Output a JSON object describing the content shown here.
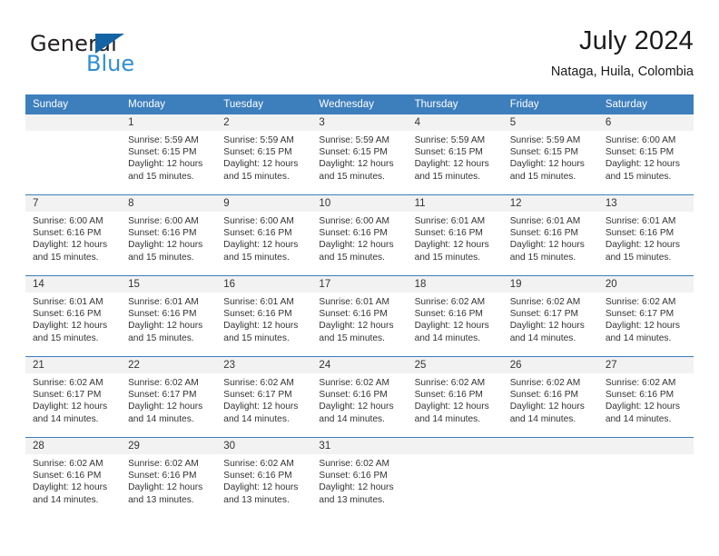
{
  "brand": {
    "name_part1": "General",
    "name_part2": "Blue",
    "accent_color": "#1464a5",
    "secondary_color": "#2e8fd4"
  },
  "header": {
    "title": "July 2024",
    "location": "Nataga, Huila, Colombia"
  },
  "theme": {
    "header_band": "#3d7ebd",
    "daynum_band": "#f2f2f2",
    "text": "#333333"
  },
  "weekday_headers": [
    "Sunday",
    "Monday",
    "Tuesday",
    "Wednesday",
    "Thursday",
    "Friday",
    "Saturday"
  ],
  "weeks": [
    [
      {
        "day": "",
        "sunrise": "",
        "sunset": "",
        "daylight_line1": "",
        "daylight_line2": ""
      },
      {
        "day": "1",
        "sunrise": "Sunrise: 5:59 AM",
        "sunset": "Sunset: 6:15 PM",
        "daylight_line1": "Daylight: 12 hours",
        "daylight_line2": "and 15 minutes."
      },
      {
        "day": "2",
        "sunrise": "Sunrise: 5:59 AM",
        "sunset": "Sunset: 6:15 PM",
        "daylight_line1": "Daylight: 12 hours",
        "daylight_line2": "and 15 minutes."
      },
      {
        "day": "3",
        "sunrise": "Sunrise: 5:59 AM",
        "sunset": "Sunset: 6:15 PM",
        "daylight_line1": "Daylight: 12 hours",
        "daylight_line2": "and 15 minutes."
      },
      {
        "day": "4",
        "sunrise": "Sunrise: 5:59 AM",
        "sunset": "Sunset: 6:15 PM",
        "daylight_line1": "Daylight: 12 hours",
        "daylight_line2": "and 15 minutes."
      },
      {
        "day": "5",
        "sunrise": "Sunrise: 5:59 AM",
        "sunset": "Sunset: 6:15 PM",
        "daylight_line1": "Daylight: 12 hours",
        "daylight_line2": "and 15 minutes."
      },
      {
        "day": "6",
        "sunrise": "Sunrise: 6:00 AM",
        "sunset": "Sunset: 6:15 PM",
        "daylight_line1": "Daylight: 12 hours",
        "daylight_line2": "and 15 minutes."
      }
    ],
    [
      {
        "day": "7",
        "sunrise": "Sunrise: 6:00 AM",
        "sunset": "Sunset: 6:16 PM",
        "daylight_line1": "Daylight: 12 hours",
        "daylight_line2": "and 15 minutes."
      },
      {
        "day": "8",
        "sunrise": "Sunrise: 6:00 AM",
        "sunset": "Sunset: 6:16 PM",
        "daylight_line1": "Daylight: 12 hours",
        "daylight_line2": "and 15 minutes."
      },
      {
        "day": "9",
        "sunrise": "Sunrise: 6:00 AM",
        "sunset": "Sunset: 6:16 PM",
        "daylight_line1": "Daylight: 12 hours",
        "daylight_line2": "and 15 minutes."
      },
      {
        "day": "10",
        "sunrise": "Sunrise: 6:00 AM",
        "sunset": "Sunset: 6:16 PM",
        "daylight_line1": "Daylight: 12 hours",
        "daylight_line2": "and 15 minutes."
      },
      {
        "day": "11",
        "sunrise": "Sunrise: 6:01 AM",
        "sunset": "Sunset: 6:16 PM",
        "daylight_line1": "Daylight: 12 hours",
        "daylight_line2": "and 15 minutes."
      },
      {
        "day": "12",
        "sunrise": "Sunrise: 6:01 AM",
        "sunset": "Sunset: 6:16 PM",
        "daylight_line1": "Daylight: 12 hours",
        "daylight_line2": "and 15 minutes."
      },
      {
        "day": "13",
        "sunrise": "Sunrise: 6:01 AM",
        "sunset": "Sunset: 6:16 PM",
        "daylight_line1": "Daylight: 12 hours",
        "daylight_line2": "and 15 minutes."
      }
    ],
    [
      {
        "day": "14",
        "sunrise": "Sunrise: 6:01 AM",
        "sunset": "Sunset: 6:16 PM",
        "daylight_line1": "Daylight: 12 hours",
        "daylight_line2": "and 15 minutes."
      },
      {
        "day": "15",
        "sunrise": "Sunrise: 6:01 AM",
        "sunset": "Sunset: 6:16 PM",
        "daylight_line1": "Daylight: 12 hours",
        "daylight_line2": "and 15 minutes."
      },
      {
        "day": "16",
        "sunrise": "Sunrise: 6:01 AM",
        "sunset": "Sunset: 6:16 PM",
        "daylight_line1": "Daylight: 12 hours",
        "daylight_line2": "and 15 minutes."
      },
      {
        "day": "17",
        "sunrise": "Sunrise: 6:01 AM",
        "sunset": "Sunset: 6:16 PM",
        "daylight_line1": "Daylight: 12 hours",
        "daylight_line2": "and 15 minutes."
      },
      {
        "day": "18",
        "sunrise": "Sunrise: 6:02 AM",
        "sunset": "Sunset: 6:16 PM",
        "daylight_line1": "Daylight: 12 hours",
        "daylight_line2": "and 14 minutes."
      },
      {
        "day": "19",
        "sunrise": "Sunrise: 6:02 AM",
        "sunset": "Sunset: 6:17 PM",
        "daylight_line1": "Daylight: 12 hours",
        "daylight_line2": "and 14 minutes."
      },
      {
        "day": "20",
        "sunrise": "Sunrise: 6:02 AM",
        "sunset": "Sunset: 6:17 PM",
        "daylight_line1": "Daylight: 12 hours",
        "daylight_line2": "and 14 minutes."
      }
    ],
    [
      {
        "day": "21",
        "sunrise": "Sunrise: 6:02 AM",
        "sunset": "Sunset: 6:17 PM",
        "daylight_line1": "Daylight: 12 hours",
        "daylight_line2": "and 14 minutes."
      },
      {
        "day": "22",
        "sunrise": "Sunrise: 6:02 AM",
        "sunset": "Sunset: 6:17 PM",
        "daylight_line1": "Daylight: 12 hours",
        "daylight_line2": "and 14 minutes."
      },
      {
        "day": "23",
        "sunrise": "Sunrise: 6:02 AM",
        "sunset": "Sunset: 6:17 PM",
        "daylight_line1": "Daylight: 12 hours",
        "daylight_line2": "and 14 minutes."
      },
      {
        "day": "24",
        "sunrise": "Sunrise: 6:02 AM",
        "sunset": "Sunset: 6:16 PM",
        "daylight_line1": "Daylight: 12 hours",
        "daylight_line2": "and 14 minutes."
      },
      {
        "day": "25",
        "sunrise": "Sunrise: 6:02 AM",
        "sunset": "Sunset: 6:16 PM",
        "daylight_line1": "Daylight: 12 hours",
        "daylight_line2": "and 14 minutes."
      },
      {
        "day": "26",
        "sunrise": "Sunrise: 6:02 AM",
        "sunset": "Sunset: 6:16 PM",
        "daylight_line1": "Daylight: 12 hours",
        "daylight_line2": "and 14 minutes."
      },
      {
        "day": "27",
        "sunrise": "Sunrise: 6:02 AM",
        "sunset": "Sunset: 6:16 PM",
        "daylight_line1": "Daylight: 12 hours",
        "daylight_line2": "and 14 minutes."
      }
    ],
    [
      {
        "day": "28",
        "sunrise": "Sunrise: 6:02 AM",
        "sunset": "Sunset: 6:16 PM",
        "daylight_line1": "Daylight: 12 hours",
        "daylight_line2": "and 14 minutes."
      },
      {
        "day": "29",
        "sunrise": "Sunrise: 6:02 AM",
        "sunset": "Sunset: 6:16 PM",
        "daylight_line1": "Daylight: 12 hours",
        "daylight_line2": "and 13 minutes."
      },
      {
        "day": "30",
        "sunrise": "Sunrise: 6:02 AM",
        "sunset": "Sunset: 6:16 PM",
        "daylight_line1": "Daylight: 12 hours",
        "daylight_line2": "and 13 minutes."
      },
      {
        "day": "31",
        "sunrise": "Sunrise: 6:02 AM",
        "sunset": "Sunset: 6:16 PM",
        "daylight_line1": "Daylight: 12 hours",
        "daylight_line2": "and 13 minutes."
      },
      {
        "day": "",
        "sunrise": "",
        "sunset": "",
        "daylight_line1": "",
        "daylight_line2": ""
      },
      {
        "day": "",
        "sunrise": "",
        "sunset": "",
        "daylight_line1": "",
        "daylight_line2": ""
      },
      {
        "day": "",
        "sunrise": "",
        "sunset": "",
        "daylight_line1": "",
        "daylight_line2": ""
      }
    ]
  ]
}
